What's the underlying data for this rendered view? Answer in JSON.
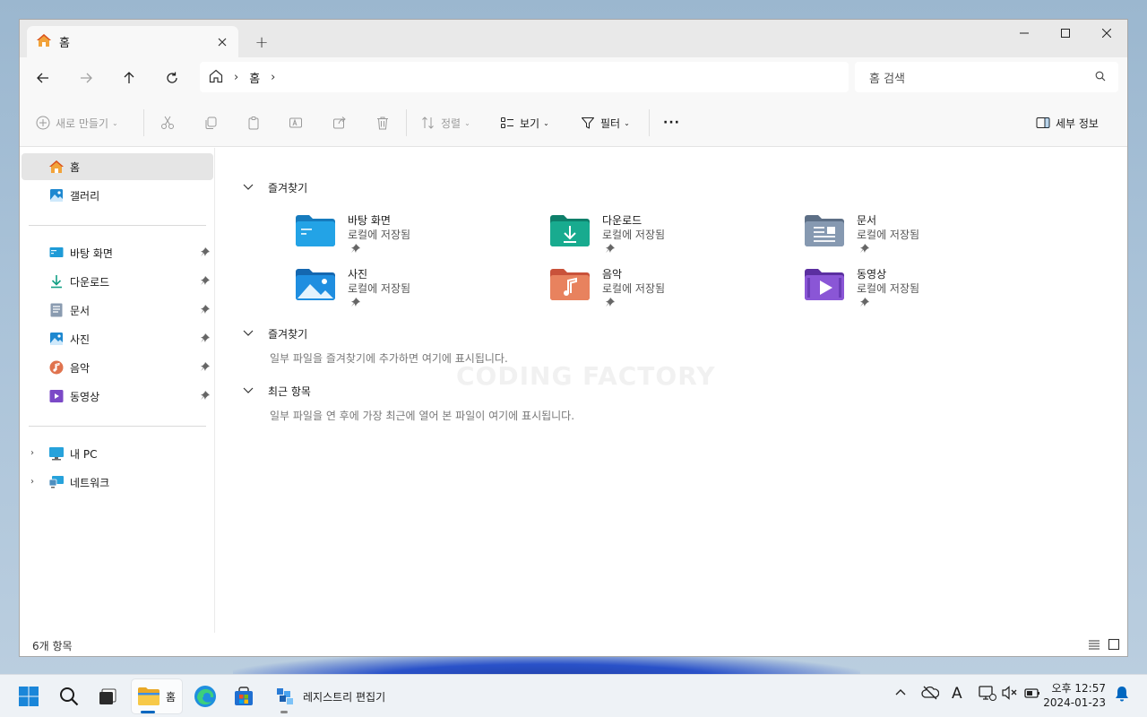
{
  "window": {
    "tab_title": "홈",
    "new_tab": "+"
  },
  "address": {
    "segments": [
      "홈"
    ],
    "search_placeholder": "홈 검색"
  },
  "commands": {
    "new": "새로 만들기",
    "sort": "정렬",
    "view": "보기",
    "filter": "필터",
    "more": "···",
    "details": "세부 정보"
  },
  "sidebar": {
    "top": [
      {
        "label": "홈",
        "icon": "home-icon"
      },
      {
        "label": "갤러리",
        "icon": "gallery-icon"
      }
    ],
    "pinned": [
      {
        "label": "바탕 화면",
        "icon": "desktop-folder-icon"
      },
      {
        "label": "다운로드",
        "icon": "downloads-icon"
      },
      {
        "label": "문서",
        "icon": "documents-icon"
      },
      {
        "label": "사진",
        "icon": "pictures-icon"
      },
      {
        "label": "음악",
        "icon": "music-icon"
      },
      {
        "label": "동영상",
        "icon": "videos-icon"
      }
    ],
    "bottom": [
      {
        "label": "내 PC",
        "icon": "this-pc-icon"
      },
      {
        "label": "네트워크",
        "icon": "network-icon"
      }
    ]
  },
  "main": {
    "quick_access_title": "즐겨찾기",
    "tiles": [
      {
        "name": "바탕 화면",
        "sub": "로컬에 저장됨"
      },
      {
        "name": "다운로드",
        "sub": "로컬에 저장됨"
      },
      {
        "name": "문서",
        "sub": "로컬에 저장됨"
      },
      {
        "name": "사진",
        "sub": "로컬에 저장됨"
      },
      {
        "name": "음악",
        "sub": "로컬에 저장됨"
      },
      {
        "name": "동영상",
        "sub": "로컬에 저장됨"
      }
    ],
    "favorites_title": "즐겨찾기",
    "favorites_note": "일부 파일을 즐겨찾기에 추가하면 여기에 표시됩니다.",
    "recent_title": "최근 항목",
    "recent_note": "일부 파일을 연 후에 가장 최근에 열어 본 파일이 여기에 표시됩니다.",
    "watermark": "CODING FACTORY"
  },
  "status": {
    "count": "6개 항목"
  },
  "taskbar": {
    "explorer_label": "홈",
    "regedit_label": "레지스트리 편집기",
    "clock_time": "오후 12:57",
    "clock_date": "2024-01-23",
    "ime": "A"
  },
  "colors": {
    "accent": "#0067c0",
    "folder_blue": "#1e9bd7",
    "folder_teal": "#14a085"
  }
}
